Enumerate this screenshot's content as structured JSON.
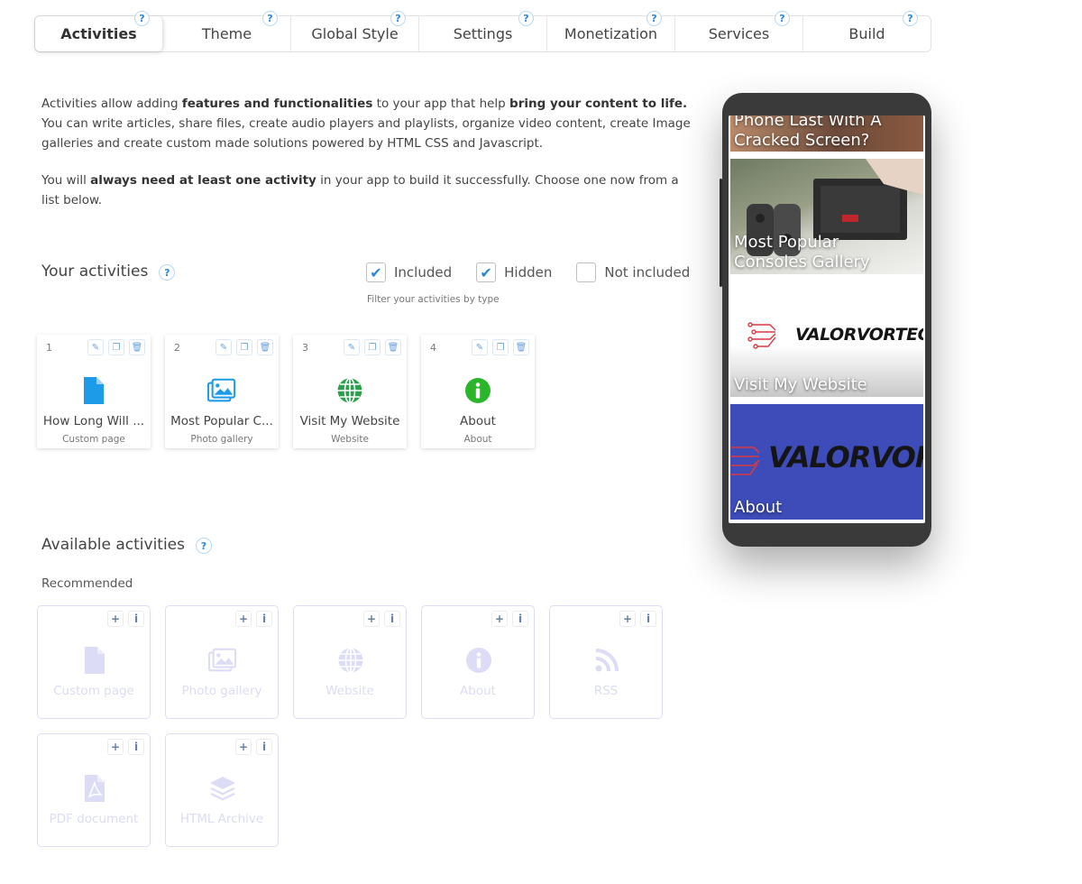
{
  "tabs": [
    {
      "label": "Activities",
      "active": true
    },
    {
      "label": "Theme"
    },
    {
      "label": "Global Style"
    },
    {
      "label": "Settings"
    },
    {
      "label": "Monetization"
    },
    {
      "label": "Services"
    },
    {
      "label": "Build"
    }
  ],
  "help_glyph": "?",
  "intro": {
    "p1_a": "Activities allow adding ",
    "p1_b": "features and functionalities",
    "p1_c": " to your app that help ",
    "p1_d": "bring your content to life.",
    "p1_e": " You can write articles, share files, create audio players and playlists, organize video content, create Image galleries and create custom made solutions powered by HTML CSS and Javascript.",
    "p2_a": "You will ",
    "p2_b": "always need at least one activity",
    "p2_c": " in your app to build it successfully. Choose one now from a list below."
  },
  "your_activities": {
    "title": "Your activities",
    "filters": [
      {
        "label": "Included",
        "checked": true
      },
      {
        "label": "Hidden",
        "checked": true
      },
      {
        "label": "Not included",
        "checked": false
      }
    ],
    "filter_hint": "Filter your activities by type",
    "items": [
      {
        "num": "1",
        "name": "How Long Will ...",
        "type": "Custom page",
        "icon": "document-icon"
      },
      {
        "num": "2",
        "name": "Most Popular C...",
        "type": "Photo gallery",
        "icon": "gallery-icon"
      },
      {
        "num": "3",
        "name": "Visit My Website",
        "type": "Website",
        "icon": "globe-icon"
      },
      {
        "num": "4",
        "name": "About",
        "type": "About",
        "icon": "info-icon"
      }
    ]
  },
  "available": {
    "title": "Available activities",
    "recommended_label": "Recommended",
    "add_glyph": "+",
    "info_glyph": "i",
    "items": [
      {
        "name": "Custom page",
        "icon": "document-icon"
      },
      {
        "name": "Photo gallery",
        "icon": "gallery-icon"
      },
      {
        "name": "Website",
        "icon": "globe-icon"
      },
      {
        "name": "About",
        "icon": "info-icon"
      },
      {
        "name": "RSS",
        "icon": "rss-icon"
      },
      {
        "name": "PDF document",
        "icon": "pdf-icon"
      },
      {
        "name": "HTML Archive",
        "icon": "layers-icon"
      }
    ]
  },
  "phone": {
    "tiles": [
      {
        "label_l1": "Phone Last With A",
        "label_l2": "Cracked Screen?"
      },
      {
        "label_l1": "Most Popular",
        "label_l2": "Consoles Gallery"
      },
      {
        "label_l1": "Visit My Website",
        "logo_text": "VALORVORTECH"
      },
      {
        "label_l1": "About",
        "logo_text": "VALORVORT"
      }
    ]
  },
  "colors": {
    "accent": "#2a88d8",
    "doc_icon": "#1e9be8",
    "globe_icon": "#2e9e4f",
    "info_icon": "#2bb52b",
    "faded": "#dcdcf6",
    "about_bg": "#3d4cb8"
  }
}
